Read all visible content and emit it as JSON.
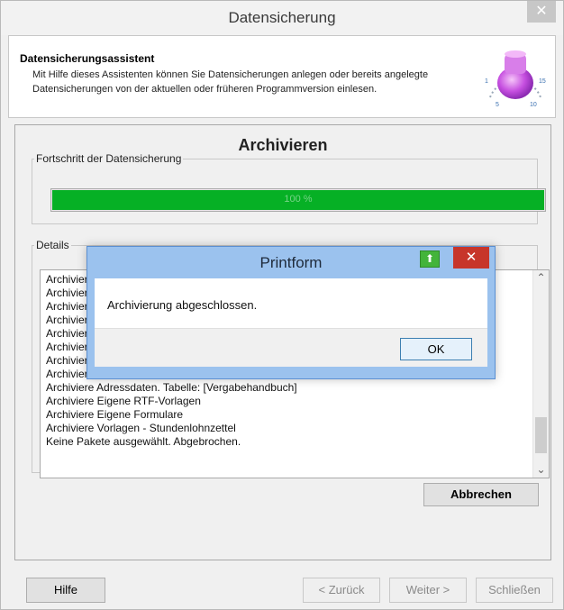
{
  "window": {
    "title": "Datensicherung",
    "close_label": "✕"
  },
  "header": {
    "title": "Datensicherungsassistent",
    "description": "Mit Hilfe dieses Assistenten können Sie Datensicherungen anlegen oder bereits angelegte Datensicherungen von der aktuellen oder früheren Programmversion einlesen.",
    "icon": "timer-bulb-icon",
    "dial_labels": {
      "l1": "1",
      "l5": "5",
      "l10": "10",
      "l15": "15"
    }
  },
  "section_title": "Archivieren",
  "progress": {
    "legend": "Fortschritt der Datensicherung",
    "value": 100,
    "text": "100 %",
    "color": "#06b025"
  },
  "details": {
    "legend": "Details",
    "lines": [
      "Archiviere",
      "Archiviere",
      "Archiviere",
      "Archiviere",
      "Archiviere",
      "Archiviere",
      "Archiviere",
      "Archiviere",
      "Archiviere Adressdaten. Tabelle: [Vergabehandbuch]",
      "Archiviere Eigene RTF-Vorlagen",
      "Archiviere Eigene Formulare",
      "Archiviere Vorlagen - Stundenlohnzettel",
      "Keine Pakete ausgewählt. Abgebrochen."
    ],
    "scroll_up": "⌃",
    "scroll_down": "⌄"
  },
  "buttons": {
    "abbrechen": "Abbrechen",
    "hilfe": "Hilfe",
    "zurueck": "< Zurück",
    "weiter": "Weiter >",
    "schliessen": "Schließen"
  },
  "dialog": {
    "title": "Printform",
    "message": "Archivierung abgeschlossen.",
    "ok": "OK",
    "close": "✕",
    "green_icon": "⬆",
    "accent": "#9bc2ee"
  }
}
